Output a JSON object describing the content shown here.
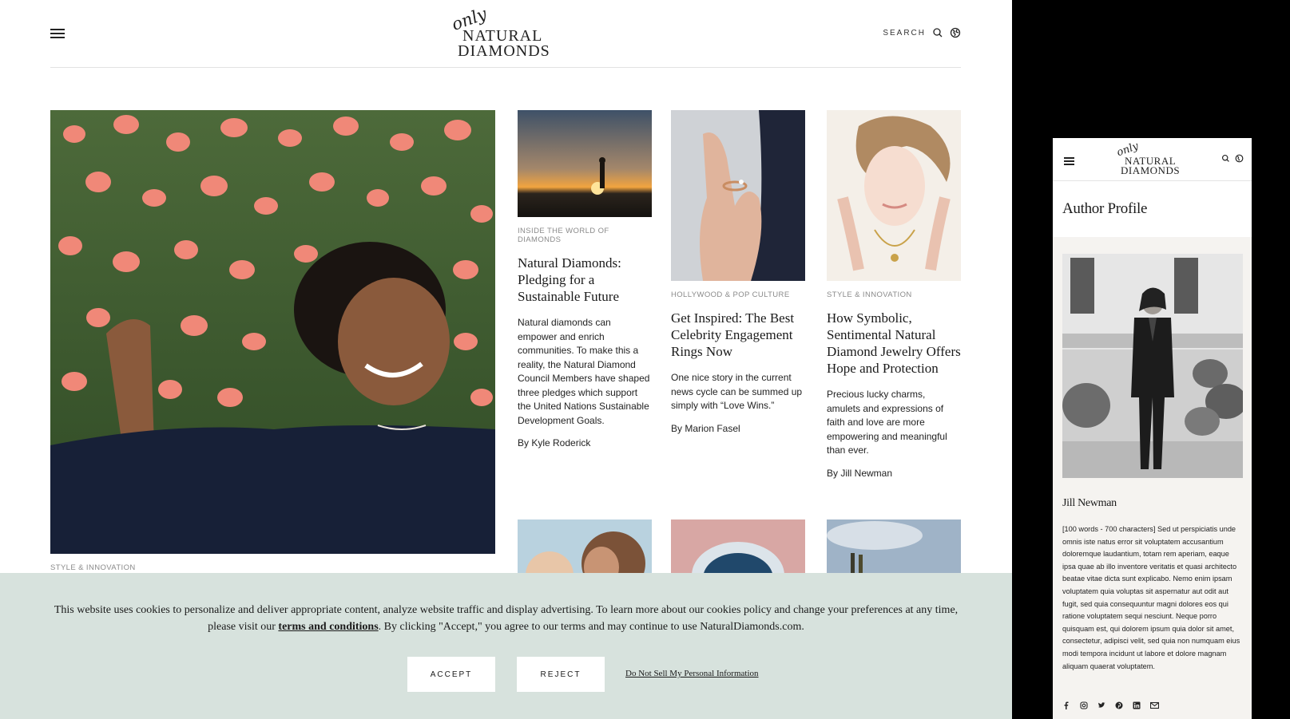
{
  "desktop": {
    "header": {
      "logo": {
        "only": "only",
        "line1": "NATURAL",
        "line2": "DIAMONDS"
      },
      "search_label": "SEARCH"
    },
    "hero": {
      "category": "STYLE & INNOVATION"
    },
    "cards": [
      {
        "category": "INSIDE THE WORLD OF DIAMONDS",
        "title": "Natural Diamonds: Pledging for a Sustainable Future",
        "excerpt": "Natural diamonds can empower and enrich communities. To make this a reality, the Natural Diamond Council Members have shaped three pledges which support the United Nations Sustainable Development Goals.",
        "byline": "By Kyle Roderick"
      },
      {
        "category": "HOLLYWOOD & POP CULTURE",
        "title": "Get Inspired: The Best Celebrity Engagement Rings Now",
        "excerpt": "One nice story in the current news cycle can be summed up simply with “Love Wins.”",
        "byline": "By Marion Fasel"
      },
      {
        "category": "STYLE & INNOVATION",
        "title": "How Symbolic, Sentimental Natural Diamond Jewelry Offers Hope and Protection",
        "excerpt": "Precious lucky charms, amulets and expressions of faith and love are more empowering and meaningful than ever.",
        "byline": "By Jill Newman"
      }
    ],
    "cookie": {
      "text_before": "This website uses cookies to personalize and deliver appropriate content, analyze website traffic and display advertising. To learn more about our cookies policy and change your preferences at any time, please visit our ",
      "link": "terms and conditions",
      "text_after": ". By clicking \"Accept,\" you agree to our terms and may continue to use NaturalDiamonds.com.",
      "accept": "ACCEPT",
      "reject": "REJECT",
      "do_not_sell": "Do Not Sell My Personal Information"
    }
  },
  "mobile": {
    "logo": {
      "only": "only",
      "line1": "NATURAL",
      "line2": "DIAMONDS"
    },
    "title": "Author Profile",
    "author_name": "Jill Newman",
    "bio": "[100 words - 700 characters] Sed ut perspiciatis unde omnis iste natus error sit voluptatem accusantium doloremque laudantium, totam rem aperiam, eaque ipsa quae ab illo inventore veritatis et quasi architecto beatae vitae dicta sunt explicabo. Nemo enim ipsam voluptatem quia voluptas sit aspernatur aut odit aut fugit, sed quia consequuntur magni dolores eos qui ratione voluptatem sequi nesciunt. Neque porro quisquam est, qui dolorem ipsum quia dolor sit amet, consectetur, adipisci velit, sed quia non numquam eius modi tempora incidunt ut labore et dolore magnam aliquam quaerat voluptatem.",
    "social_icons": [
      "facebook-icon",
      "instagram-icon",
      "twitter-icon",
      "pinterest-icon",
      "linkedin-icon",
      "email-icon"
    ]
  },
  "colors": {
    "cookie_bg": "#d7e2dd",
    "mobile_bg": "#f5f3f0",
    "text": "#1a1a1a",
    "category": "#8a8a8a"
  }
}
